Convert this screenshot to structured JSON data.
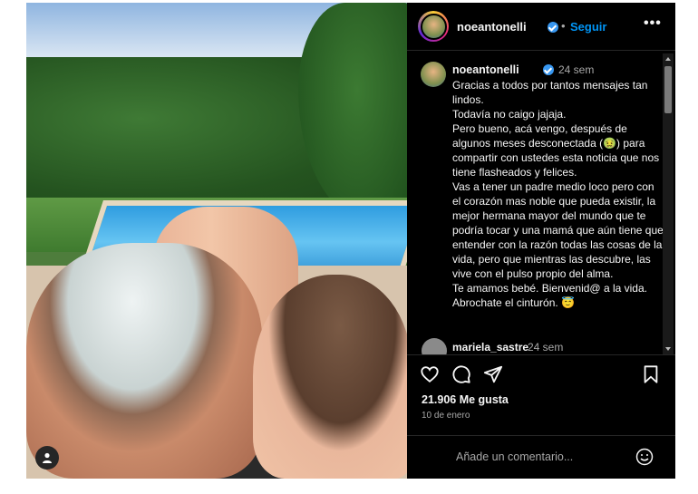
{
  "post": {
    "username": "noeantonelli",
    "follow_label": "Seguir",
    "separator": "•",
    "more_label": "•••"
  },
  "caption": {
    "username": "noeantonelli",
    "time": "24 sem",
    "text": "Gracias a todos por tantos mensajes tan lindos.\nTodavía no caigo jajaja.\nPero bueno, acá vengo, después de algunos meses desconectada (🤢) para compartir con ustedes esta noticia que nos tiene flasheados y felices.\nVas a tener un padre medio loco pero con el corazón mas noble que pueda existir, la mejor hermana mayor del mundo que te podría tocar y una mamá que aún tiene que entender con la razón todas las cosas de la vida, pero que mientras las descubre, las vive con el pulso propio del alma.\nTe amamos bebé. Bienvenid@ a la vida.\nAbrochate el cinturón. 😇"
  },
  "comments": [
    {
      "username": "mariela_sastre",
      "time": "24 sem"
    }
  ],
  "stats": {
    "likes": "21.906 Me gusta",
    "date": "10 de enero"
  },
  "comment_box": {
    "placeholder": "Añade un comentario..."
  },
  "icons": [
    "heart-icon",
    "comment-icon",
    "share-icon",
    "bookmark-icon",
    "emoji-icon",
    "user-tag-icon",
    "verified-icon",
    "more-icon"
  ],
  "colors": {
    "accent": "#0095f6",
    "verified": "#3897f0",
    "background": "#000000"
  }
}
